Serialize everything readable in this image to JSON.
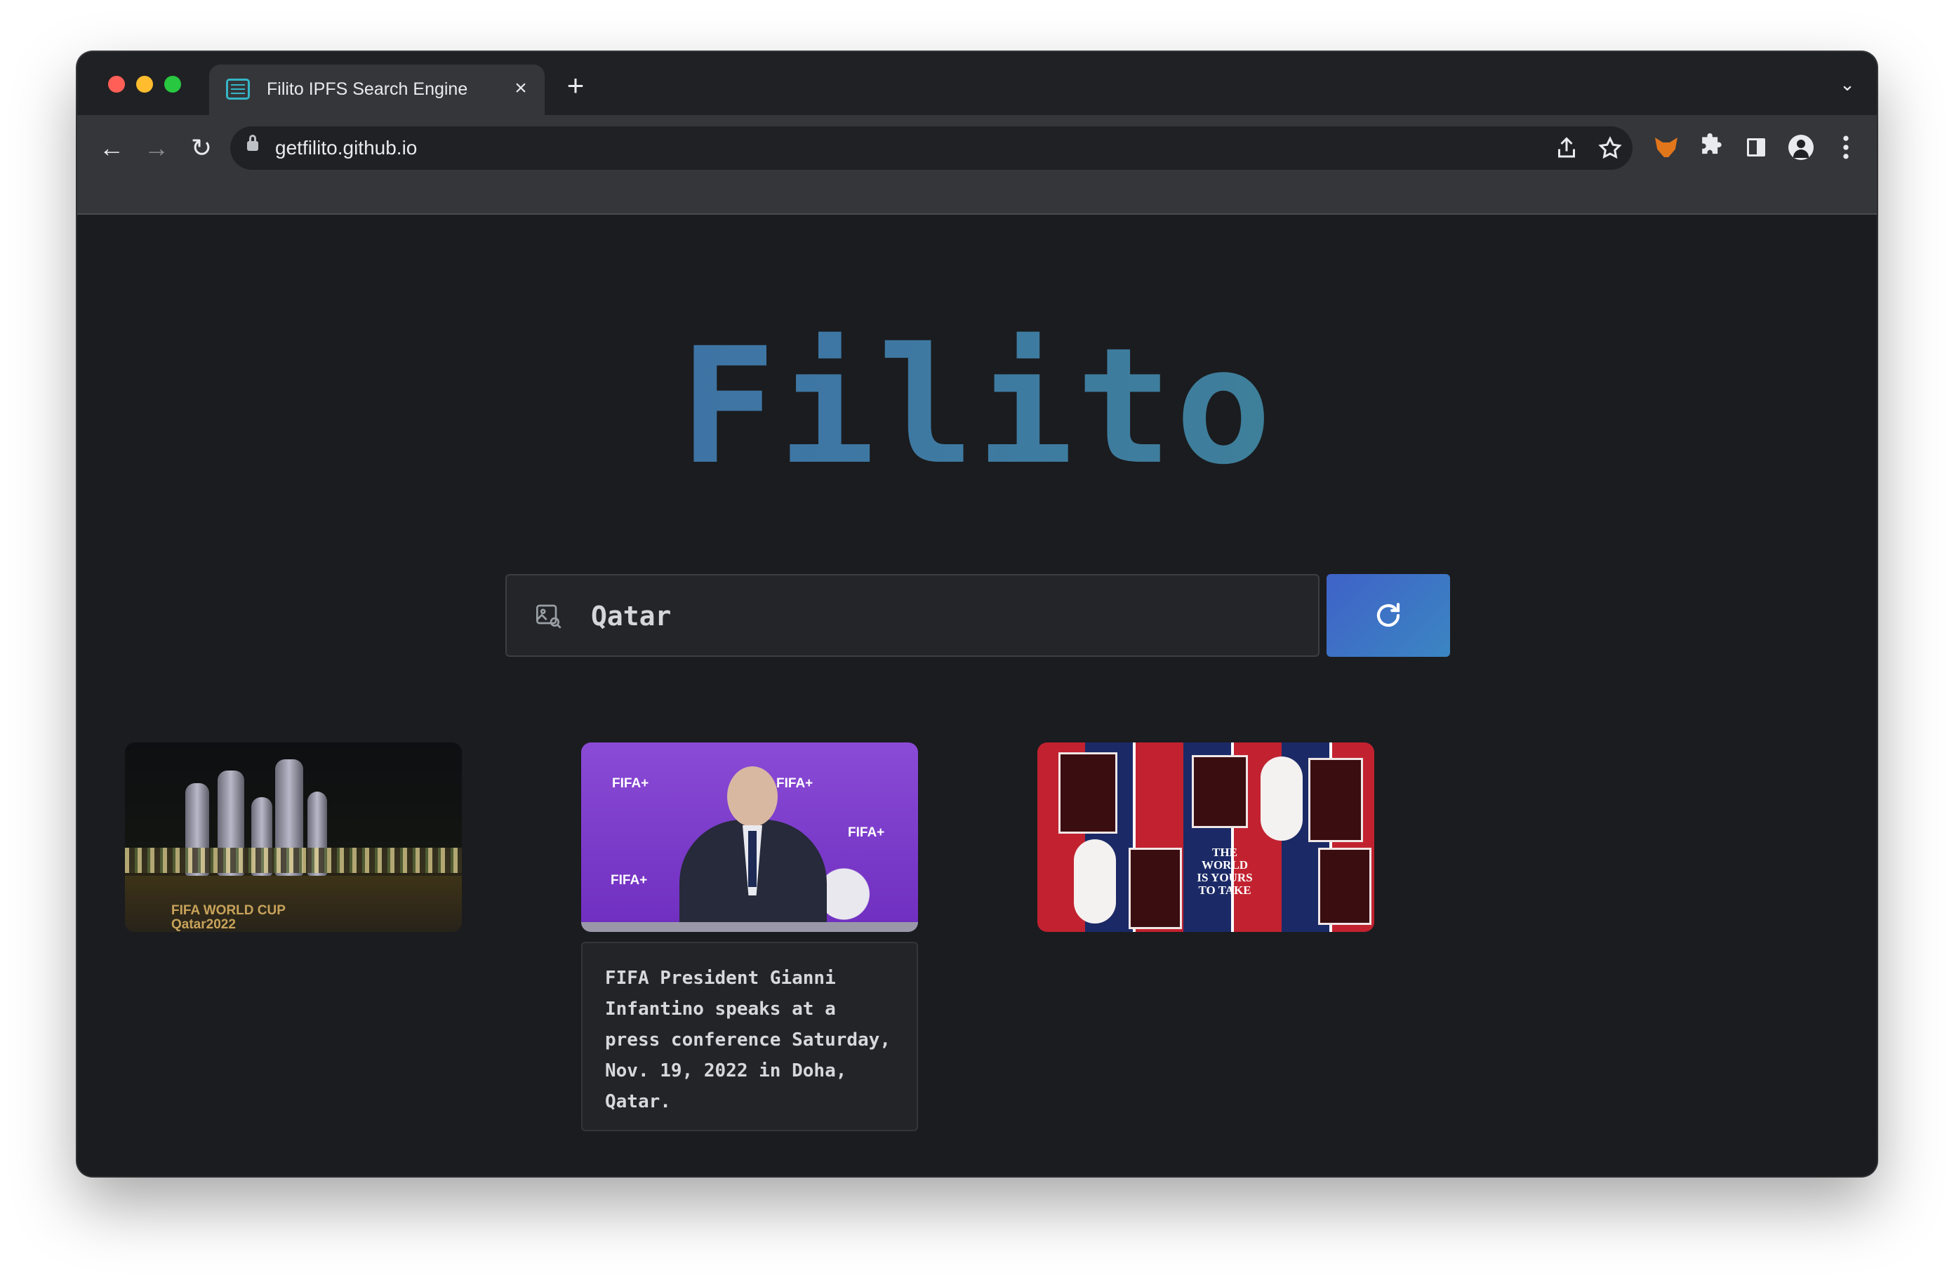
{
  "browser": {
    "tab_title": "Filito IPFS Search Engine",
    "tab_close": "×",
    "new_tab": "+",
    "tab_menu": "⌄",
    "url": "getfilito.github.io",
    "nav": {
      "back": "←",
      "forward": "→",
      "reload": "↻"
    },
    "icons": [
      "share-icon",
      "star-icon",
      "metamask-fox-icon",
      "puzzle-icon",
      "side-panel-icon",
      "profile-icon",
      "kebab-menu-icon"
    ]
  },
  "page": {
    "logo": "Filito",
    "search": {
      "value": "Qatar"
    },
    "results": [
      {
        "type": "image",
        "banner_text": "FIFA WORLD CUP Qatar2022"
      },
      {
        "type": "image",
        "banner_labels": [
          "FIFA+",
          "FIFA+",
          "FIFA+",
          "FIFA+"
        ],
        "caption": "FIFA President Gianni Infantino speaks at a press conference Saturday, Nov. 19, 2022 in Doha, Qatar."
      },
      {
        "type": "image",
        "poster_text": "THE WORLD IS YOURS TO TAKE"
      }
    ]
  },
  "colors": {
    "accent_blue": "#3f62c8",
    "logo_gradient": [
      "#3f67ad",
      "#3d8a8c"
    ],
    "background": "#1b1c1f"
  }
}
